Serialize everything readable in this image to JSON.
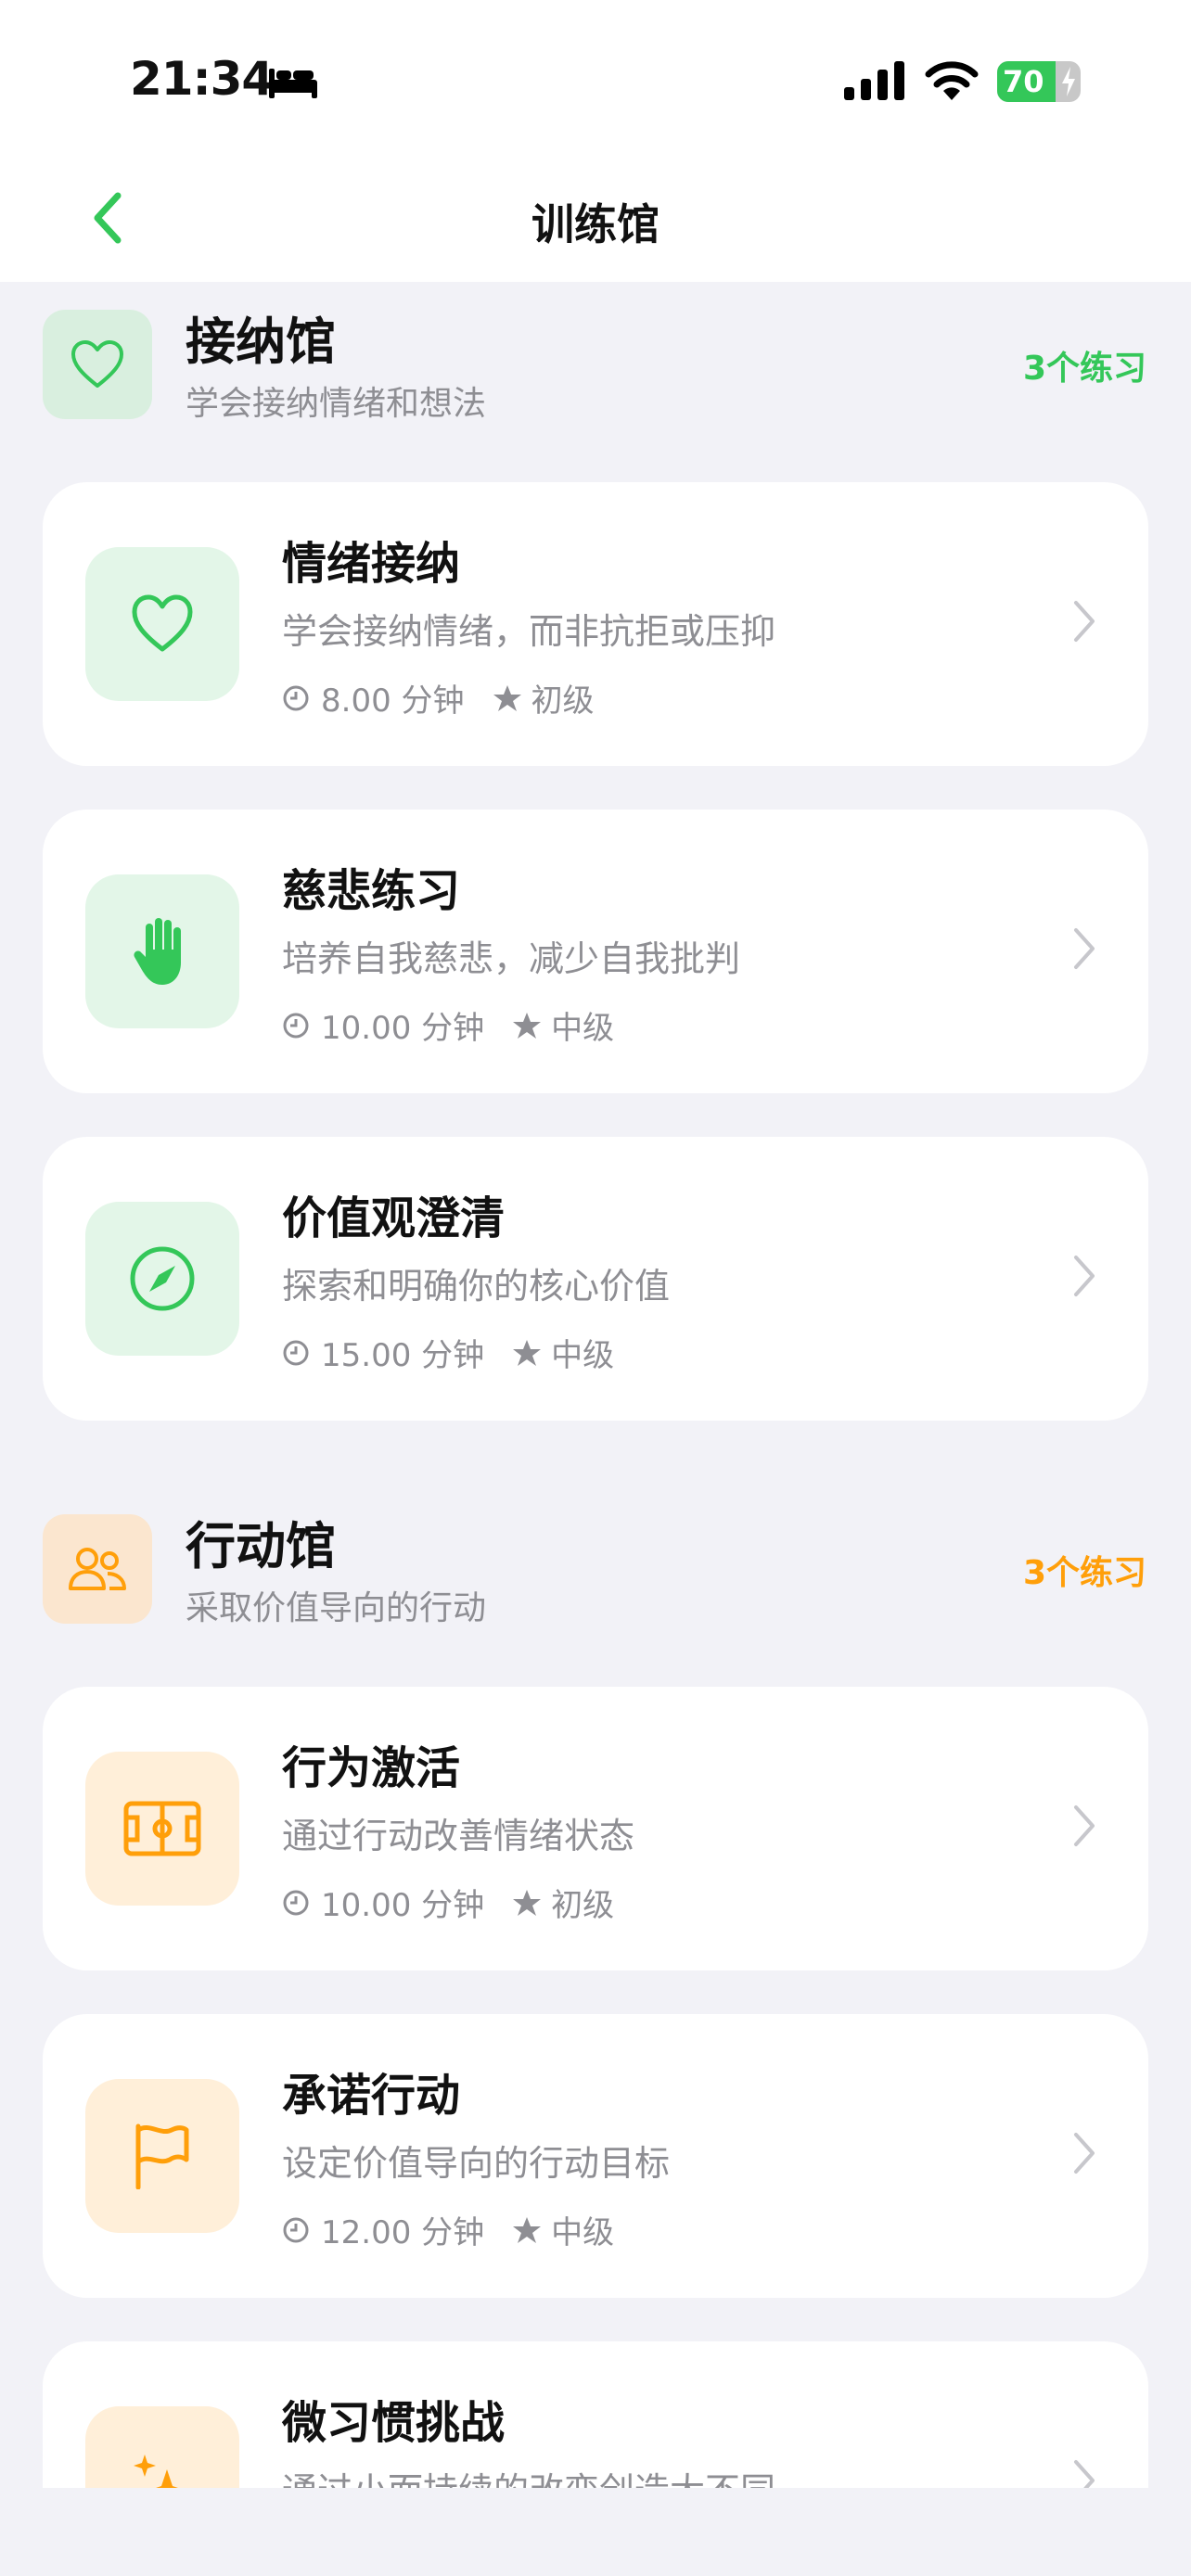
{
  "status": {
    "time": "21:34",
    "battery": "70",
    "battery_level": 0.7
  },
  "nav": {
    "title": "训练馆"
  },
  "colors": {
    "green": "#34c759",
    "orange": "#ff9f0a"
  },
  "sections": [
    {
      "title": "接纳馆",
      "subtitle": "学会接纳情绪和想法",
      "count": "3个练习",
      "icon": "heart-icon",
      "items": [
        {
          "title": "情绪接纳",
          "desc": "学会接纳情绪，而非抗拒或压抑",
          "duration": "8.00 分钟",
          "level": "初级",
          "icon": "heart-icon"
        },
        {
          "title": "慈悲练习",
          "desc": "培养自我慈悲，减少自我批判",
          "duration": "10.00 分钟",
          "level": "中级",
          "icon": "hand-icon"
        },
        {
          "title": "价值观澄清",
          "desc": "探索和明确你的核心价值",
          "duration": "15.00 分钟",
          "level": "中级",
          "icon": "compass-icon"
        }
      ]
    },
    {
      "title": "行动馆",
      "subtitle": "采取价值导向的行动",
      "count": "3个练习",
      "icon": "people-icon",
      "items": [
        {
          "title": "行为激活",
          "desc": "通过行动改善情绪状态",
          "duration": "10.00 分钟",
          "level": "初级",
          "icon": "field-icon"
        },
        {
          "title": "承诺行动",
          "desc": "设定价值导向的行动目标",
          "duration": "12.00 分钟",
          "level": "中级",
          "icon": "flag-icon"
        },
        {
          "title": "微习惯挑战",
          "desc": "通过小而持续的改变创造大不同",
          "icon": "sparkles-icon"
        }
      ]
    }
  ]
}
